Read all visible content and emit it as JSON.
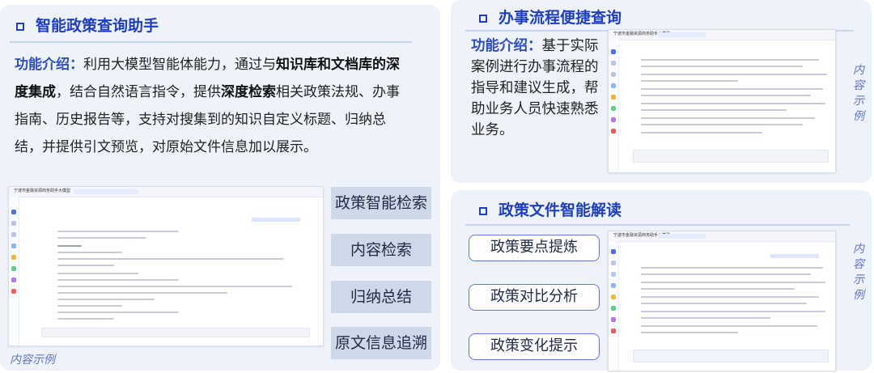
{
  "panel_left": {
    "title": "智能政策查询助手",
    "intro": {
      "label": "功能介绍：",
      "part1": "利用大模型智能体能力，通过与",
      "bold1": "知识库和文档库的深度集成",
      "part2": "，结合自然语言指令，提供",
      "bold2": "深度检索",
      "part3": "相关政策法规、办事指南、历史报告等，支持对搜集到的知识自定义标题、归纳总结，并提供引文预览，对原始文件信息加以展示。"
    },
    "screenshot": {
      "app_title": "宁波市金融资源商务助手大模型"
    },
    "features": [
      "政策智能检索",
      "内容检索",
      "归纳总结",
      "原文信息追溯"
    ],
    "example_label": "内容示例"
  },
  "panel_top_right": {
    "title": "办事流程便捷查询",
    "intro": {
      "label": "功能介绍：",
      "text": "基于实际案例进行办事流程的指导和建议生成，帮助业务人员快速熟悉业务。"
    },
    "screenshot": {
      "app_title": "宁波市金融资源商务助手大模型"
    },
    "example_label": "内容示例"
  },
  "panel_bottom_right": {
    "title": "政策文件智能解读",
    "features": [
      "政策要点提炼",
      "政策对比分析",
      "政策变化提示"
    ],
    "screenshot": {
      "app_title": "宁波市金融资源商务助手大模型"
    },
    "example_label": "内容示例"
  },
  "colors": {
    "title": "#1f3fbf",
    "panel_bg": "#eef2fb",
    "gray_button": "#cfd8e8",
    "outline_button": "#5a7ed6",
    "example_text": "#6378c9"
  }
}
